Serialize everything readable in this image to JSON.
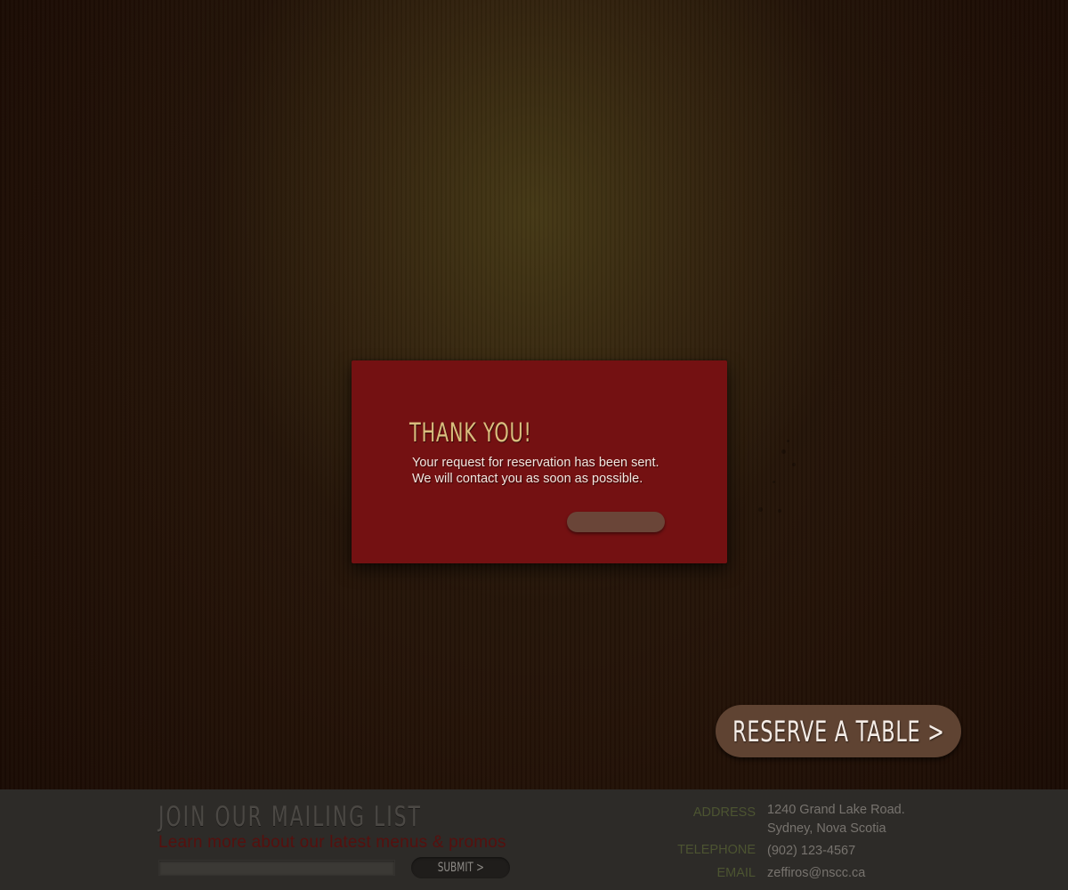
{
  "modal": {
    "title": "THANK YOU!",
    "message_line1": "Your request for reservation has been sent.",
    "message_line2": "We will contact you as soon as possible.",
    "close_button_label": ""
  },
  "reserve_button": {
    "label": "RESERVE A TABLE >"
  },
  "footer": {
    "mailing_title": "JOIN OUR MAILING LIST",
    "mailing_subtitle": "Learn more about our latest menus & promos",
    "email_input_value": "",
    "submit_label": "SUBMIT >",
    "contact": {
      "address_label": "ADDRESS",
      "address_line1": "1240 Grand Lake Road.",
      "address_line2": "Sydney, Nova Scotia",
      "telephone_label": "TELEPHONE",
      "telephone_value": "(902) 123-4567",
      "email_label": "EMAIL",
      "email_value": "zeffiros@nscc.ca"
    }
  },
  "colors": {
    "modal_background": "#741112",
    "modal_title": "#d9bd7d",
    "reserve_button": "#5f4332",
    "footer_background": "#2d2b28",
    "mailing_subtitle": "#56100e",
    "contact_label": "#4c5431"
  }
}
